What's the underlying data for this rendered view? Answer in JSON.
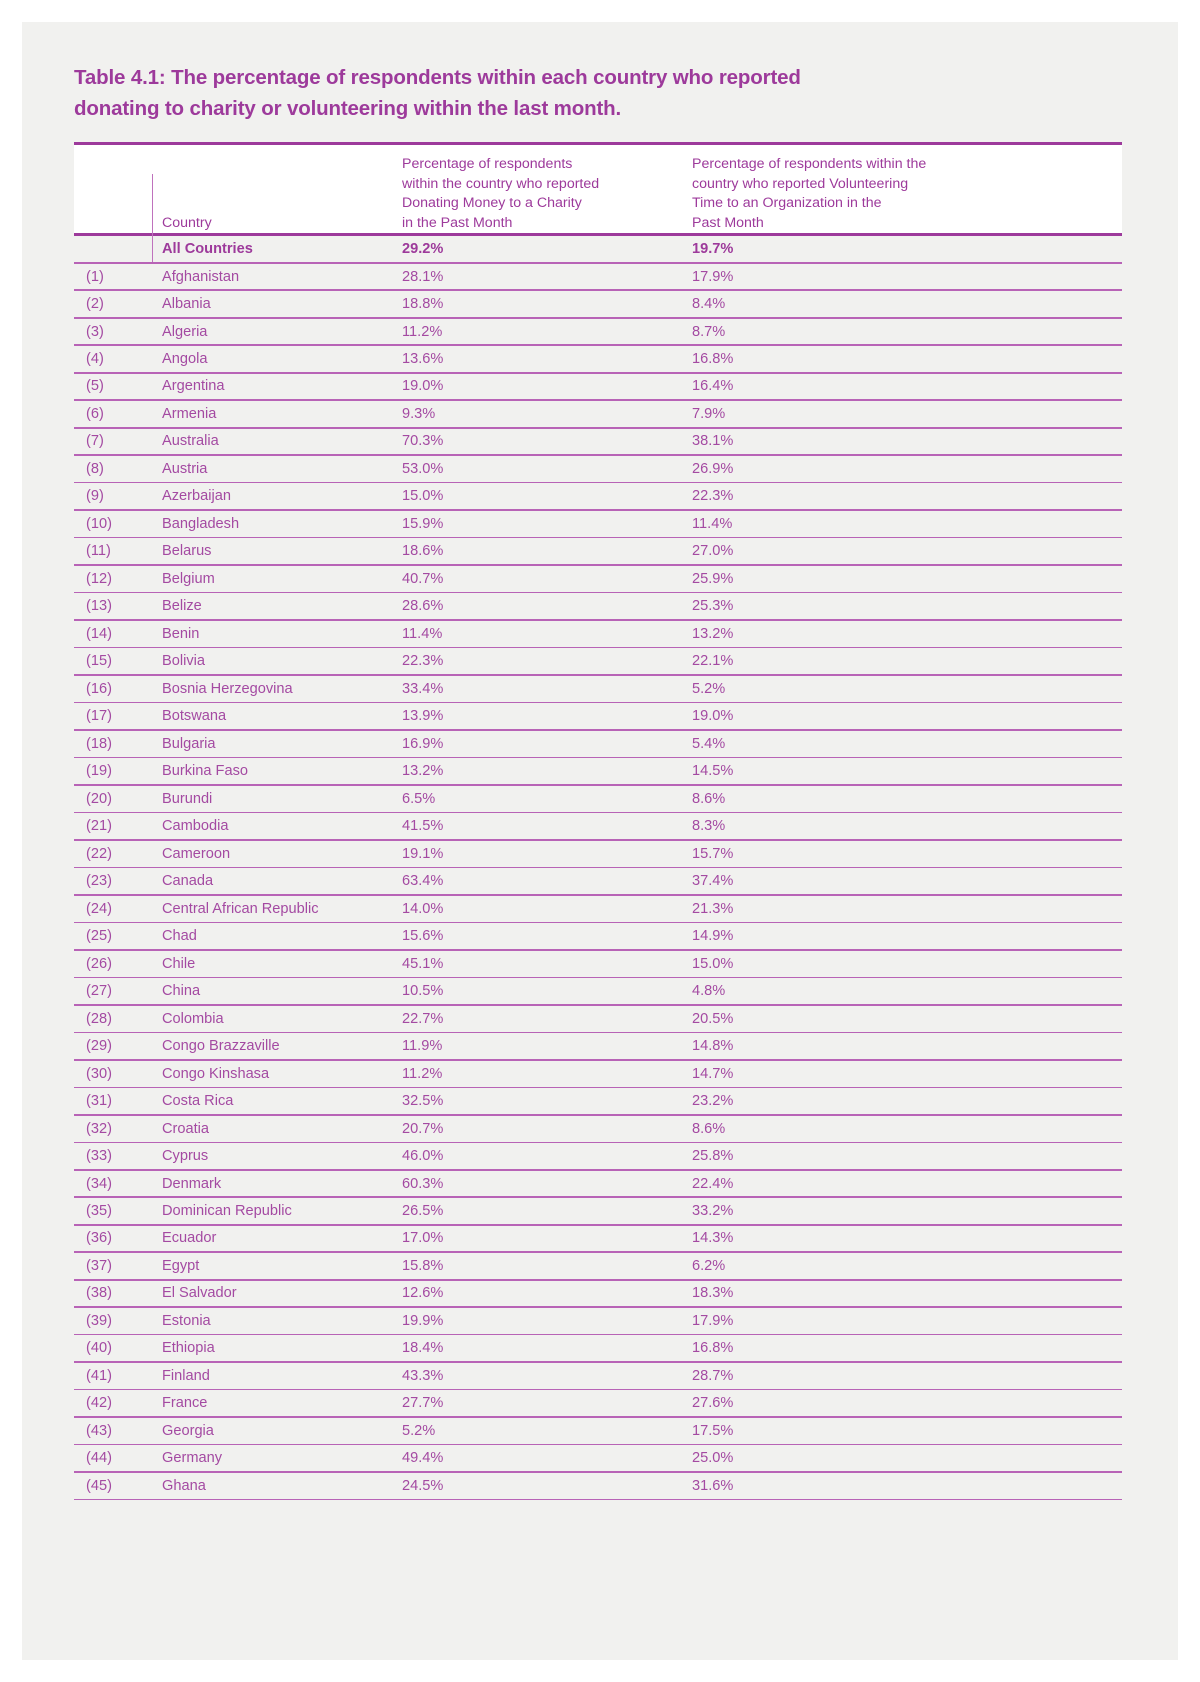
{
  "title": {
    "line1": "Table 4.1: The percentage of respondents within each country who reported",
    "line2": "donating to charity or volunteering within the last month."
  },
  "colors": {
    "accent": "#9d3a9b",
    "text": "#a44aa2",
    "rule_thick": "#9d3a9b",
    "rule_thin": "#b863b6",
    "page_bg": "#f1f1ef",
    "header_bg": "#ffffff"
  },
  "table": {
    "headers": {
      "index": "",
      "country": "Country",
      "donating": "Percentage of respondents\nwithin the country who reported\nDonating Money to a Charity\nin the Past Month",
      "volunteering": "Percentage of respondents within the\ncountry who reported Volunteering\nTime to an Organization in the\nPast Month"
    },
    "total_row": {
      "index": "",
      "country": "All Countries",
      "donating": "29.2%",
      "volunteering": "19.7%"
    },
    "rows": [
      {
        "index": "(1)",
        "country": "Afghanistan",
        "donating": "28.1%",
        "volunteering": "17.9%"
      },
      {
        "index": "(2)",
        "country": "Albania",
        "donating": "18.8%",
        "volunteering": "8.4%"
      },
      {
        "index": "(3)",
        "country": "Algeria",
        "donating": "11.2%",
        "volunteering": "8.7%"
      },
      {
        "index": "(4)",
        "country": "Angola",
        "donating": "13.6%",
        "volunteering": "16.8%"
      },
      {
        "index": "(5)",
        "country": "Argentina",
        "donating": "19.0%",
        "volunteering": "16.4%"
      },
      {
        "index": "(6)",
        "country": "Armenia",
        "donating": "9.3%",
        "volunteering": "7.9%"
      },
      {
        "index": "(7)",
        "country": "Australia",
        "donating": "70.3%",
        "volunteering": "38.1%"
      },
      {
        "index": "(8)",
        "country": "Austria",
        "donating": "53.0%",
        "volunteering": "26.9%"
      },
      {
        "index": "(9)",
        "country": "Azerbaijan",
        "donating": "15.0%",
        "volunteering": "22.3%"
      },
      {
        "index": "(10)",
        "country": "Bangladesh",
        "donating": "15.9%",
        "volunteering": "11.4%"
      },
      {
        "index": "(11)",
        "country": "Belarus",
        "donating": "18.6%",
        "volunteering": "27.0%"
      },
      {
        "index": "(12)",
        "country": "Belgium",
        "donating": "40.7%",
        "volunteering": "25.9%"
      },
      {
        "index": "(13)",
        "country": "Belize",
        "donating": "28.6%",
        "volunteering": "25.3%"
      },
      {
        "index": "(14)",
        "country": "Benin",
        "donating": "11.4%",
        "volunteering": "13.2%"
      },
      {
        "index": "(15)",
        "country": "Bolivia",
        "donating": "22.3%",
        "volunteering": "22.1%"
      },
      {
        "index": "(16)",
        "country": "Bosnia Herzegovina",
        "donating": "33.4%",
        "volunteering": "5.2%"
      },
      {
        "index": "(17)",
        "country": "Botswana",
        "donating": "13.9%",
        "volunteering": "19.0%"
      },
      {
        "index": "(18)",
        "country": "Bulgaria",
        "donating": "16.9%",
        "volunteering": "5.4%"
      },
      {
        "index": "(19)",
        "country": "Burkina Faso",
        "donating": "13.2%",
        "volunteering": "14.5%"
      },
      {
        "index": "(20)",
        "country": "Burundi",
        "donating": "6.5%",
        "volunteering": "8.6%"
      },
      {
        "index": "(21)",
        "country": "Cambodia",
        "donating": "41.5%",
        "volunteering": "8.3%"
      },
      {
        "index": "(22)",
        "country": "Cameroon",
        "donating": "19.1%",
        "volunteering": "15.7%"
      },
      {
        "index": "(23)",
        "country": "Canada",
        "donating": "63.4%",
        "volunteering": "37.4%"
      },
      {
        "index": "(24)",
        "country": "Central African Republic",
        "donating": "14.0%",
        "volunteering": "21.3%"
      },
      {
        "index": "(25)",
        "country": "Chad",
        "donating": "15.6%",
        "volunteering": "14.9%"
      },
      {
        "index": "(26)",
        "country": "Chile",
        "donating": "45.1%",
        "volunteering": "15.0%"
      },
      {
        "index": "(27)",
        "country": "China",
        "donating": "10.5%",
        "volunteering": "4.8%"
      },
      {
        "index": "(28)",
        "country": "Colombia",
        "donating": "22.7%",
        "volunteering": "20.5%"
      },
      {
        "index": "(29)",
        "country": "Congo Brazzaville",
        "donating": "11.9%",
        "volunteering": "14.8%"
      },
      {
        "index": "(30)",
        "country": "Congo Kinshasa",
        "donating": "11.2%",
        "volunteering": "14.7%"
      },
      {
        "index": "(31)",
        "country": "Costa Rica",
        "donating": "32.5%",
        "volunteering": "23.2%"
      },
      {
        "index": "(32)",
        "country": "Croatia",
        "donating": "20.7%",
        "volunteering": "8.6%"
      },
      {
        "index": "(33)",
        "country": "Cyprus",
        "donating": "46.0%",
        "volunteering": "25.8%"
      },
      {
        "index": "(34)",
        "country": "Denmark",
        "donating": "60.3%",
        "volunteering": "22.4%"
      },
      {
        "index": "(35)",
        "country": "Dominican Republic",
        "donating": "26.5%",
        "volunteering": "33.2%"
      },
      {
        "index": "(36)",
        "country": "Ecuador",
        "donating": "17.0%",
        "volunteering": "14.3%"
      },
      {
        "index": "(37)",
        "country": "Egypt",
        "donating": "15.8%",
        "volunteering": "6.2%"
      },
      {
        "index": "(38)",
        "country": "El Salvador",
        "donating": "12.6%",
        "volunteering": "18.3%"
      },
      {
        "index": "(39)",
        "country": "Estonia",
        "donating": "19.9%",
        "volunteering": "17.9%"
      },
      {
        "index": "(40)",
        "country": "Ethiopia",
        "donating": "18.4%",
        "volunteering": "16.8%"
      },
      {
        "index": "(41)",
        "country": "Finland",
        "donating": "43.3%",
        "volunteering": "28.7%"
      },
      {
        "index": "(42)",
        "country": "France",
        "donating": "27.7%",
        "volunteering": "27.6%"
      },
      {
        "index": "(43)",
        "country": "Georgia",
        "donating": "5.2%",
        "volunteering": "17.5%"
      },
      {
        "index": "(44)",
        "country": "Germany",
        "donating": "49.4%",
        "volunteering": "25.0%"
      },
      {
        "index": "(45)",
        "country": "Ghana",
        "donating": "24.5%",
        "volunteering": "31.6%"
      }
    ]
  }
}
